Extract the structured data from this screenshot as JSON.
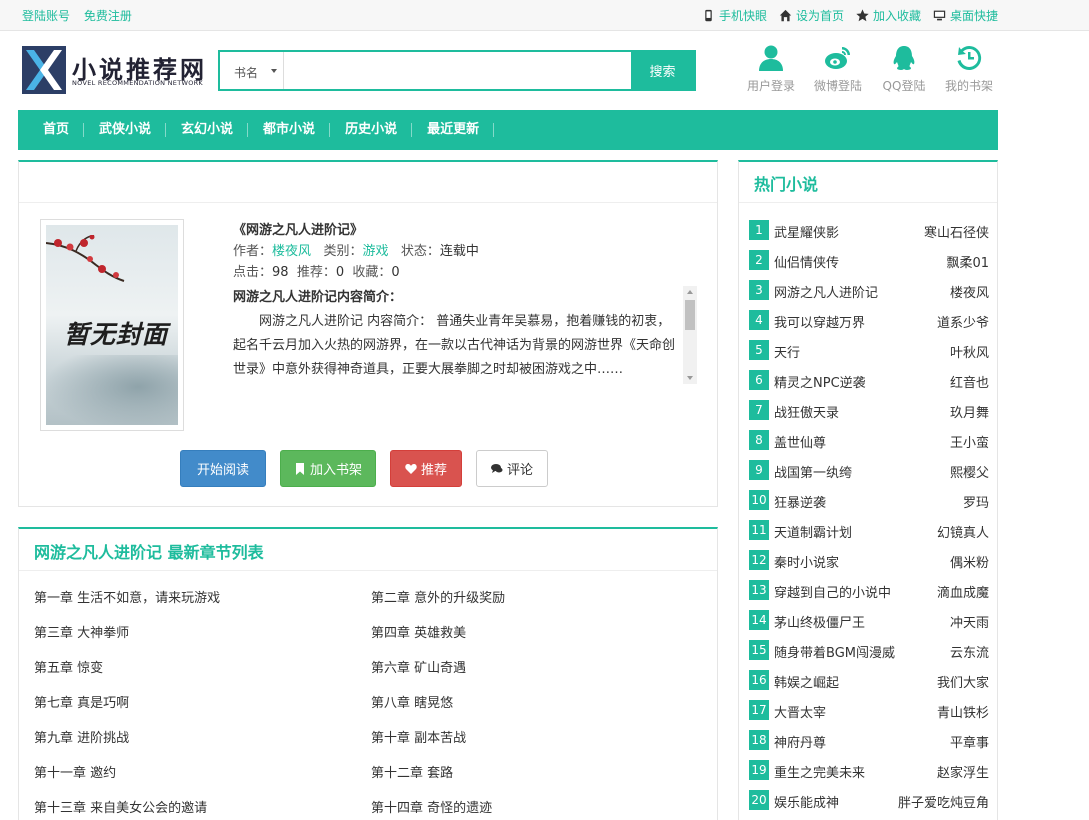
{
  "topbar": {
    "login": "登陆账号",
    "register": "免费注册",
    "links": [
      {
        "icon": "mobile-icon",
        "label": "手机快眼"
      },
      {
        "icon": "home-icon",
        "label": "设为首页"
      },
      {
        "icon": "star-icon",
        "label": "加入收藏"
      },
      {
        "icon": "desktop-icon",
        "label": "桌面快捷"
      }
    ]
  },
  "logo": {
    "name": "小说推荐网",
    "en": "NOVEL RECOMMENDATION NETWORK"
  },
  "search": {
    "select": "书名",
    "placeholder": "",
    "button": "搜索"
  },
  "quick": [
    {
      "icon": "user-icon",
      "label": "用户登录"
    },
    {
      "icon": "weibo-icon",
      "label": "微博登陆"
    },
    {
      "icon": "qq-icon",
      "label": "QQ登陆"
    },
    {
      "icon": "history-icon",
      "label": "我的书架"
    }
  ],
  "nav": [
    "首页",
    "武侠小说",
    "玄幻小说",
    "都市小说",
    "历史小说",
    "最近更新"
  ],
  "book": {
    "cover_text": "暂无封面",
    "title": "《网游之凡人进阶记》",
    "author_label": "作者：",
    "author": "楼夜风",
    "category_label": "类别：",
    "category": "游戏",
    "status_label": "状态：",
    "status": "连载中",
    "clicks_label": "点击：",
    "clicks": "98",
    "recommend_label": "推荐：",
    "recommend": "0",
    "favorites_label": "收藏：",
    "favorites": "0",
    "desc_heading": "网游之凡人进阶记内容简介：",
    "desc": "网游之凡人进阶记 内容简介： 普通失业青年吴慕易，抱着赚钱的初衷，起名千云月加入火热的网游界，在一款以古代神话为背景的网游世界《天命创世录》中意外获得神奇道具，正要大展拳脚之时却被困游戏之中……",
    "actions": [
      "开始阅读",
      "加入书架",
      "推荐",
      "评论"
    ]
  },
  "chapters": {
    "heading": "网游之凡人进阶记 最新章节列表",
    "items": [
      "第一章 生活不如意，请来玩游戏",
      "第二章 意外的升级奖励",
      "第三章 大神拳师",
      "第四章 英雄救美",
      "第五章 惊变",
      "第六章 矿山奇遇",
      "第七章 真是巧啊",
      "第八章 瞎晃悠",
      "第九章 进阶挑战",
      "第十章 副本苦战",
      "第十一章 邀约",
      "第十二章 套路",
      "第十三章 来自美女公会的邀请",
      "第十四章 奇怪的遗迹"
    ]
  },
  "hot": {
    "heading": "热门小说",
    "items": [
      {
        "num": "1",
        "title": "武星耀侠影",
        "author": "寒山石径侠"
      },
      {
        "num": "2",
        "title": "仙侣情侠传",
        "author": "飘柔01"
      },
      {
        "num": "3",
        "title": "网游之凡人进阶记",
        "author": "楼夜风"
      },
      {
        "num": "4",
        "title": "我可以穿越万界",
        "author": "道系少爷"
      },
      {
        "num": "5",
        "title": "天行",
        "author": "叶秋风"
      },
      {
        "num": "6",
        "title": "精灵之NPC逆袭",
        "author": "红音也"
      },
      {
        "num": "7",
        "title": "战狂傲天录",
        "author": "玖月舞"
      },
      {
        "num": "8",
        "title": "盖世仙尊",
        "author": "王小蛮"
      },
      {
        "num": "9",
        "title": "战国第一纨绔",
        "author": "熙樱父"
      },
      {
        "num": "10",
        "title": "狂暴逆袭",
        "author": "罗玛"
      },
      {
        "num": "11",
        "title": "天道制霸计划",
        "author": "幻镜真人"
      },
      {
        "num": "12",
        "title": "秦时小说家",
        "author": "偶米粉"
      },
      {
        "num": "13",
        "title": "穿越到自己的小说中",
        "author": "滴血成魔"
      },
      {
        "num": "14",
        "title": "茅山终极僵尸王",
        "author": "冲天雨"
      },
      {
        "num": "15",
        "title": "随身带着BGM闯漫威",
        "author": "云东流"
      },
      {
        "num": "16",
        "title": "韩娱之崛起",
        "author": "我们大家"
      },
      {
        "num": "17",
        "title": "大晋太宰",
        "author": "青山铁杉"
      },
      {
        "num": "18",
        "title": "神府丹尊",
        "author": "平章事"
      },
      {
        "num": "19",
        "title": "重生之完美未来",
        "author": "赵家浮生"
      },
      {
        "num": "20",
        "title": "娱乐能成神",
        "author": "胖子爱吃炖豆角"
      }
    ]
  },
  "colors": {
    "accent": "#1ebc9d",
    "primary": "#428bca",
    "success": "#5cb85c",
    "danger": "#d9534f"
  }
}
